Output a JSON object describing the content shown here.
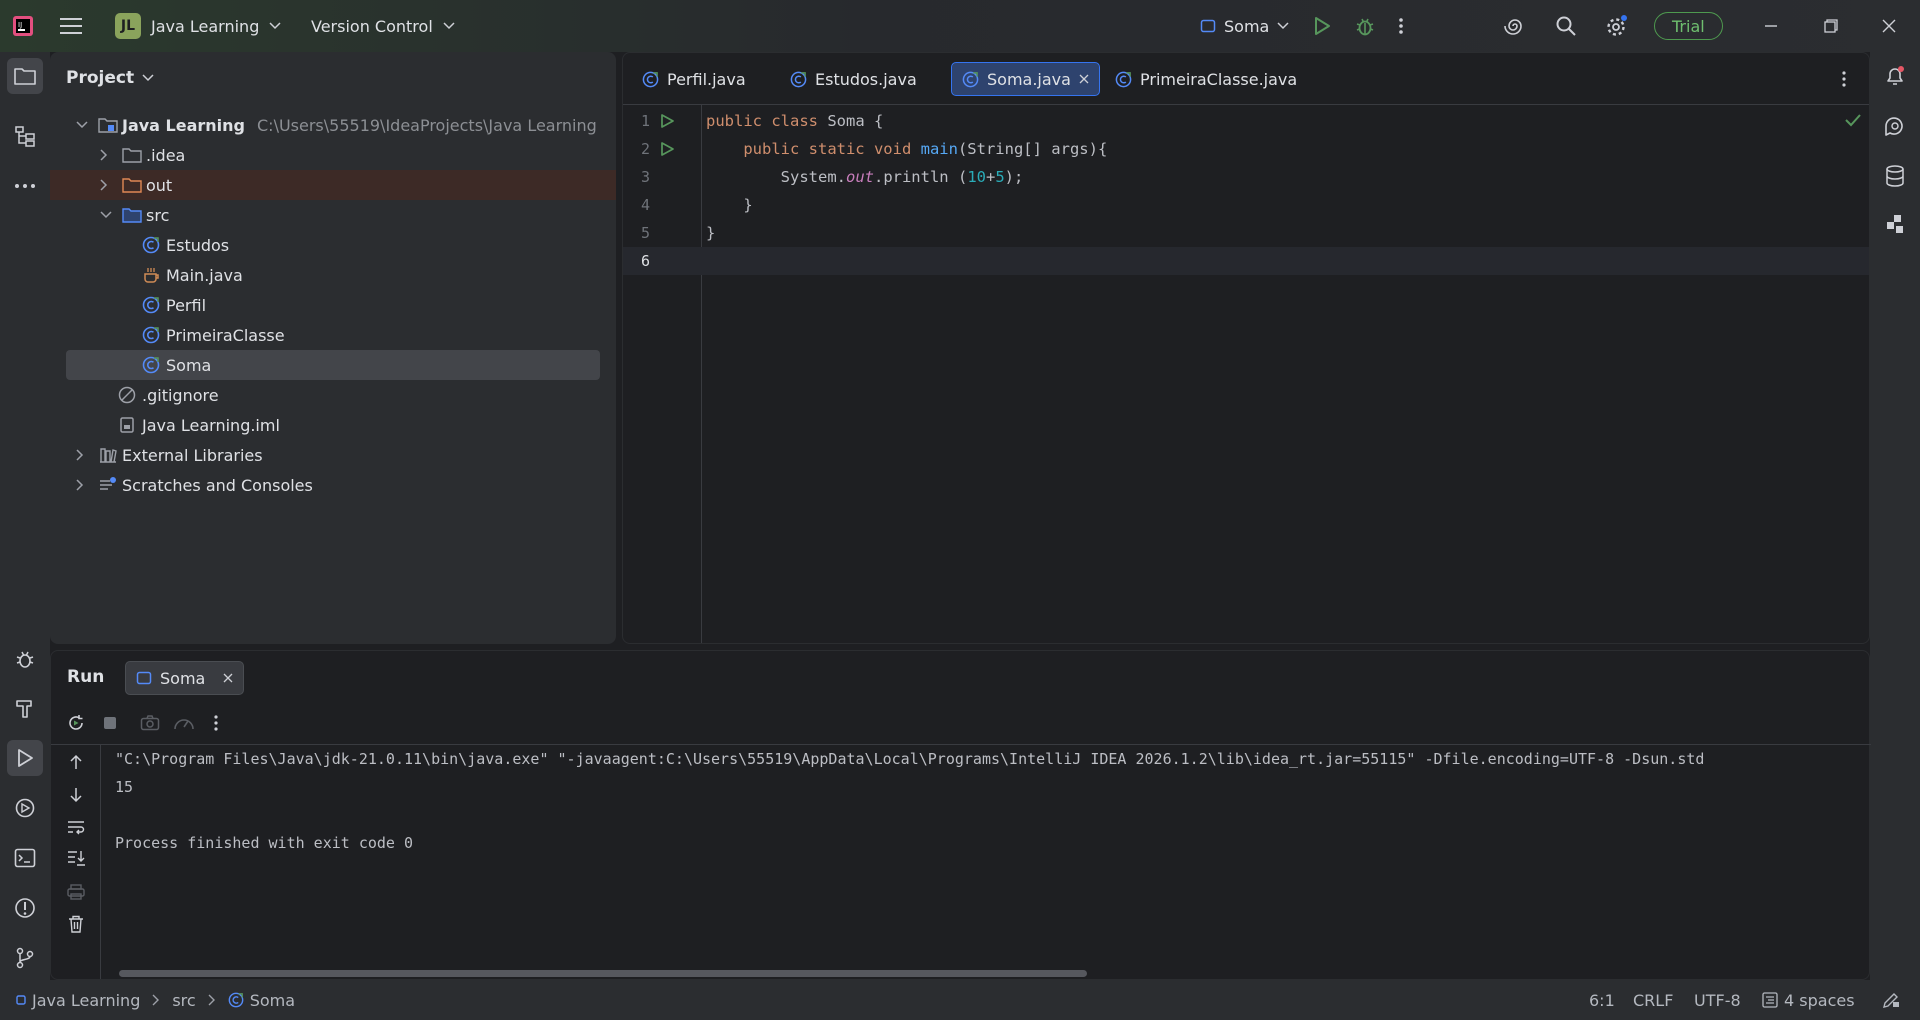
{
  "titlebar": {
    "project_initials": "JL",
    "project_name": "Java Learning",
    "vcs_label": "Version Control",
    "run_config": "Soma",
    "trial_label": "Trial"
  },
  "project_panel": {
    "title": "Project",
    "root": {
      "name": "Java Learning",
      "path": "C:\\Users\\55519\\IdeaProjects\\Java Learning"
    },
    "items": [
      {
        "label": ".idea"
      },
      {
        "label": "out"
      },
      {
        "label": "src"
      },
      {
        "label": "Estudos"
      },
      {
        "label": "Main.java"
      },
      {
        "label": "Perfil"
      },
      {
        "label": "PrimeiraClasse"
      },
      {
        "label": "Soma"
      },
      {
        "label": ".gitignore"
      },
      {
        "label": "Java Learning.iml"
      },
      {
        "label": "External Libraries"
      },
      {
        "label": "Scratches and Consoles"
      }
    ]
  },
  "editor": {
    "tabs": [
      {
        "label": "Perfil.java"
      },
      {
        "label": "Estudos.java"
      },
      {
        "label": "Soma.java"
      },
      {
        "label": "PrimeiraClasse.java"
      }
    ],
    "line_numbers": [
      "1",
      "2",
      "3",
      "4",
      "5",
      "6"
    ],
    "code": {
      "l1_kw": "public class ",
      "l1_rest": "Soma {",
      "l2_indent": "    ",
      "l2_kw": "public static void ",
      "l2_fn": "main",
      "l2_rest": "(String[] args){",
      "l3_indent": "        ",
      "l3_a": "System.",
      "l3_fld": "out",
      "l3_b": ".println (",
      "l3_n1": "10",
      "l3_op": "+",
      "l3_n2": "5",
      "l3_c": ");",
      "l4": "    }",
      "l5": "}"
    }
  },
  "run_panel": {
    "title": "Run",
    "tab_label": "Soma",
    "console_lines": [
      "\"C:\\Program Files\\Java\\jdk-21.0.11\\bin\\java.exe\" \"-javaagent:C:\\Users\\55519\\AppData\\Local\\Programs\\IntelliJ IDEA 2026.1.2\\lib\\idea_rt.jar=55115\" -Dfile.encoding=UTF-8 -Dsun.std",
      "15",
      "",
      "Process finished with exit code 0"
    ]
  },
  "statusbar": {
    "crumb_project": "Java Learning",
    "crumb_src": "src",
    "crumb_file": "Soma",
    "position": "6:1",
    "line_sep": "CRLF",
    "encoding": "UTF-8",
    "indent": "4 spaces"
  },
  "colors": {
    "accent": "#3574f0",
    "run_green": "#57965c",
    "trial_green": "#4e9a4f",
    "class_icon": "#548af7"
  }
}
